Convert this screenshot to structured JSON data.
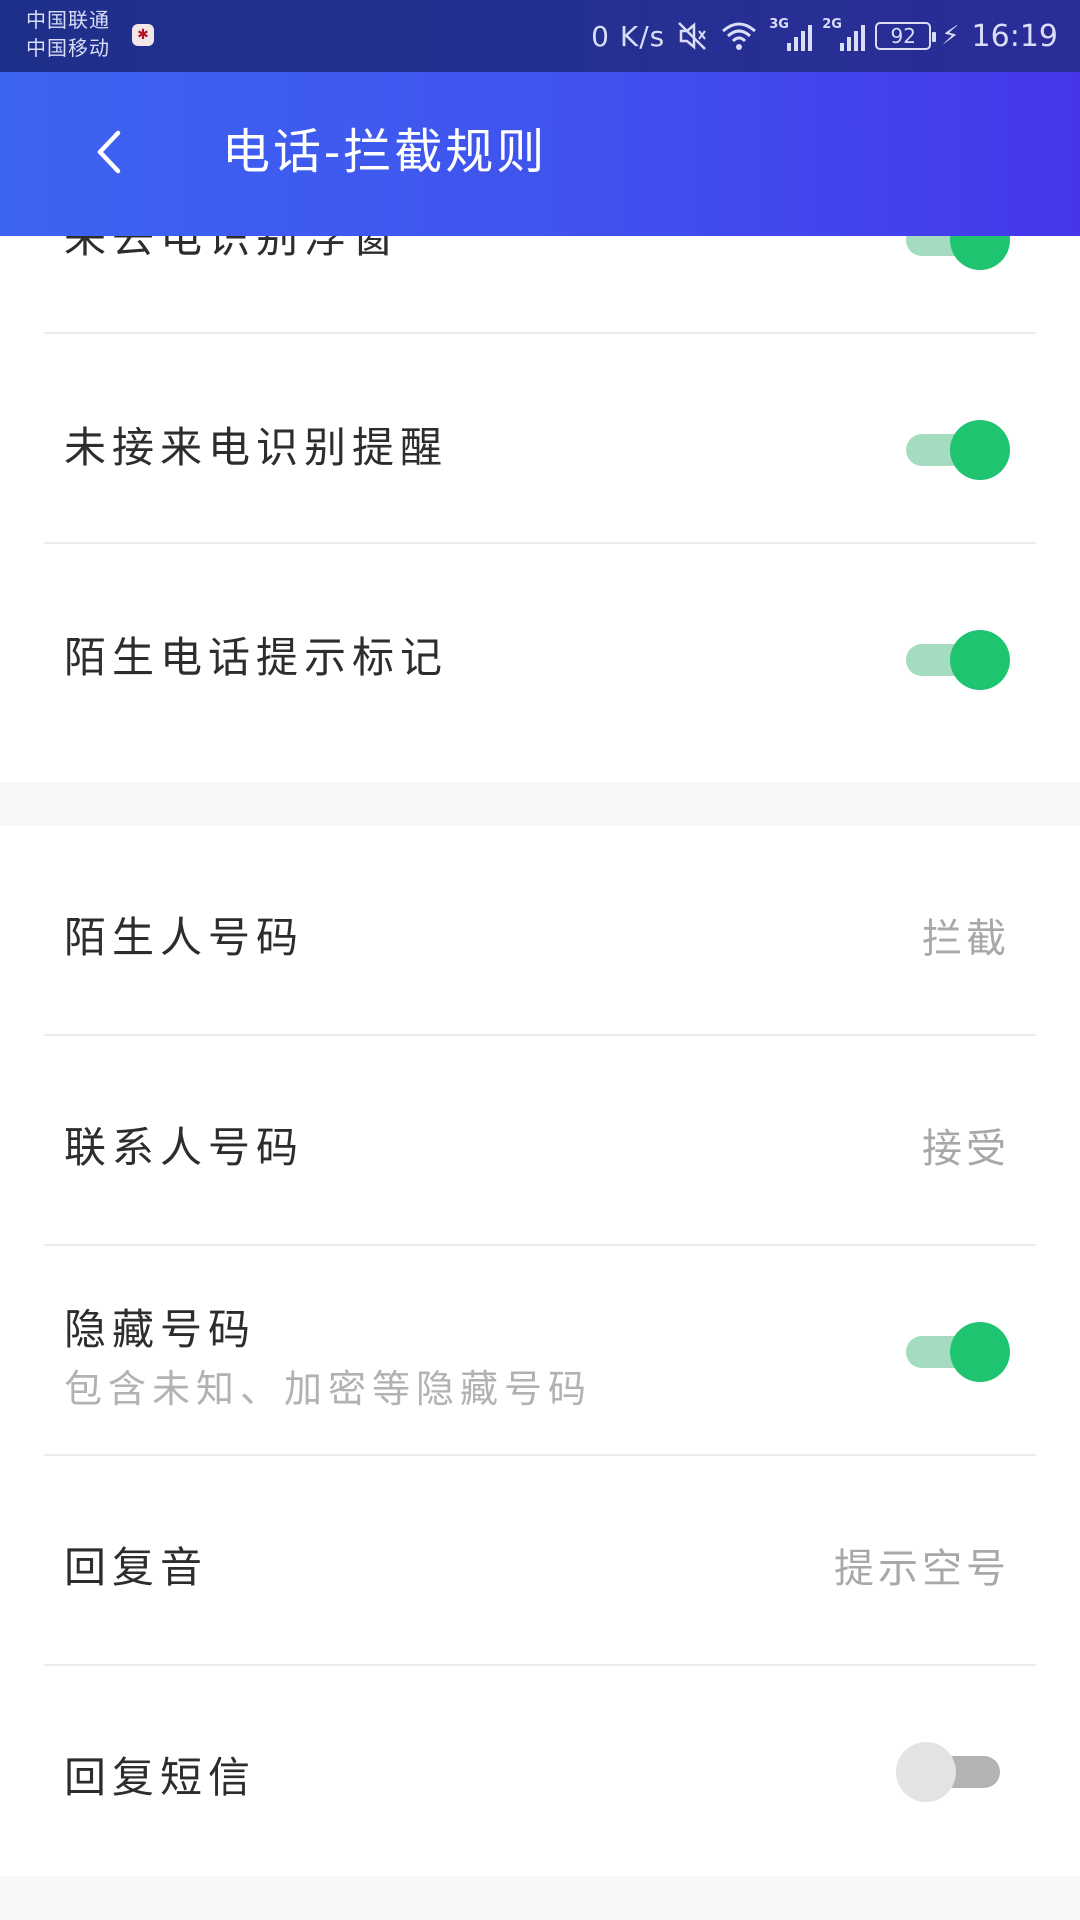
{
  "status_bar": {
    "carrier_1": "中国联通",
    "carrier_2": "中国移动",
    "net_speed": "0 K/s",
    "signal_1_tag": "3G",
    "signal_2_tag": "2G",
    "battery": "92",
    "time": "16:19"
  },
  "header": {
    "title": "电话-拦截规则",
    "back_icon": "chevron-left-icon"
  },
  "settings_group_1": [
    {
      "label": "来去电识别浮窗",
      "toggle_on": true
    },
    {
      "label": "未接来电识别提醒",
      "toggle_on": true
    },
    {
      "label": "陌生电话提示标记",
      "toggle_on": true
    }
  ],
  "settings_group_2": {
    "stranger_numbers": {
      "label": "陌生人号码",
      "value": "拦截"
    },
    "contact_numbers": {
      "label": "联系人号码",
      "value": "接受"
    },
    "hidden_numbers": {
      "label": "隐藏号码",
      "sub": "包含未知、加密等隐藏号码",
      "toggle_on": true
    },
    "reply_tone": {
      "label": "回复音",
      "value": "提示空号"
    },
    "reply_sms": {
      "label": "回复短信",
      "toggle_on": false
    }
  },
  "colors": {
    "appbar_start": "#3d64f0",
    "appbar_end": "#4536ea",
    "toggle_on": "#1ec46f",
    "toggle_on_track": "#a4dcbf"
  }
}
